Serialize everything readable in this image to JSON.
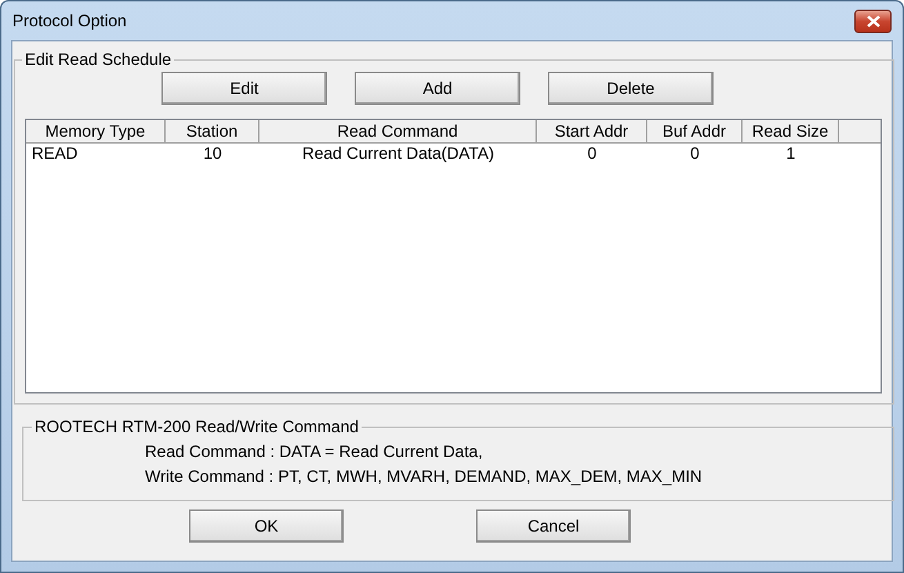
{
  "window": {
    "title": "Protocol Option"
  },
  "schedule": {
    "title": "Edit Read Schedule",
    "buttons": [
      "Edit",
      "Add",
      "Delete"
    ],
    "columns": [
      "Memory Type",
      "Station",
      "Read Command",
      "Start Addr",
      "Buf Addr",
      "Read Size"
    ],
    "rows": [
      [
        "READ",
        "10",
        "Read Current Data(DATA)",
        "0",
        "0",
        "1"
      ]
    ]
  },
  "commands": {
    "title": "ROOTECH RTM-200 Read/Write Command",
    "lines": [
      "Read Command : DATA = Read Current Data,",
      "Write Command : PT, CT, MWH, MVARH, DEMAND, MAX_DEM, MAX_MIN"
    ]
  },
  "buttons": [
    "OK",
    "Cancel"
  ]
}
